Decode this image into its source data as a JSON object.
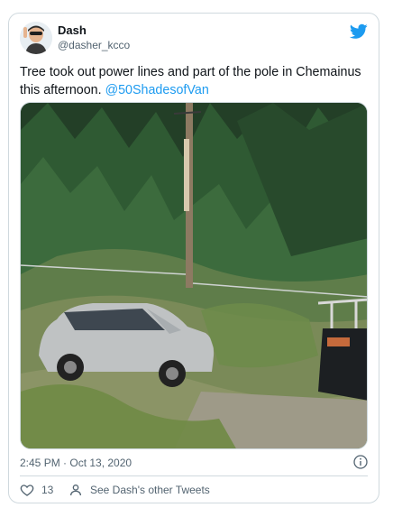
{
  "tweet": {
    "display_name": "Dash",
    "handle": "@dasher_kcco",
    "text": "Tree took out power lines and part of the pole in Chemainus this afternoon. ",
    "mention": "@50ShadesofVan",
    "timestamp": "2:45 PM · Oct 13, 2020",
    "like_count": "13",
    "other_tweets_label": "See Dash's other Tweets"
  },
  "icons": {
    "brand": "twitter-bird-icon",
    "info": "info-icon",
    "like": "heart-icon",
    "profile": "person-icon"
  },
  "colors": {
    "accent": "#1d9bf0",
    "text": "#0f1419",
    "secondary": "#536471",
    "border": "#cfd9de"
  }
}
